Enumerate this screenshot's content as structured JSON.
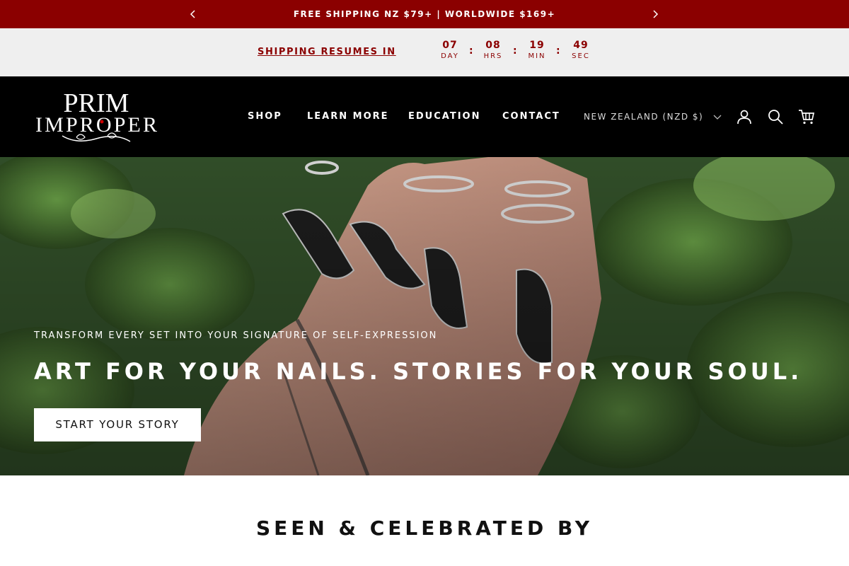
{
  "announcement": {
    "text": "FREE SHIPPING NZ $79+ | WORLDWIDE $169+"
  },
  "countdown": {
    "label": "SHIPPING RESUMES IN",
    "units": [
      {
        "value": "07",
        "label": "DAY"
      },
      {
        "value": "08",
        "label": "HRS"
      },
      {
        "value": "19",
        "label": "MIN"
      },
      {
        "value": "49",
        "label": "SEC"
      }
    ],
    "separator": ":"
  },
  "header": {
    "nav": [
      "SHOP",
      "LEARN MORE",
      "EDUCATION",
      "CONTACT"
    ],
    "currency": "NEW ZEALAND (NZD $)",
    "icons": [
      "account-icon",
      "search-icon",
      "cart-icon"
    ]
  },
  "logo": {
    "line1": "PRIM",
    "line2": "IMPROPER"
  },
  "hero": {
    "subtitle": "TRANSFORM EVERY SET INTO YOUR SIGNATURE OF SELF-EXPRESSION",
    "title": "ART FOR YOUR NAILS. STORIES FOR YOUR SOUL.",
    "cta": "START YOUR STORY"
  },
  "section": {
    "heading": "SEEN & CELEBRATED BY"
  },
  "colors": {
    "brand": "#8b0000",
    "header_bg": "#000000",
    "countdown_bg": "#efefef"
  }
}
